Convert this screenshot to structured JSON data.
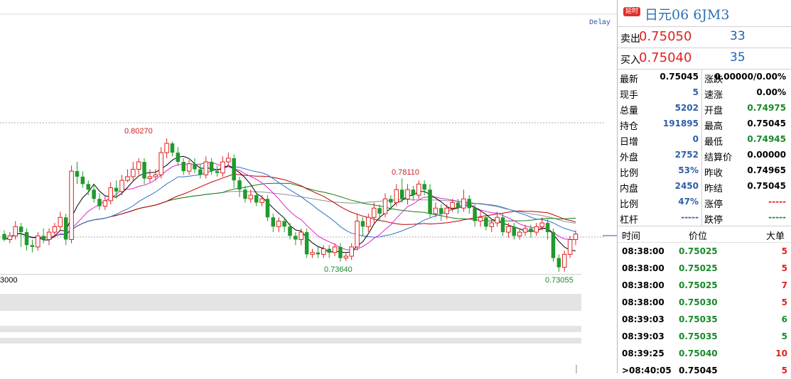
{
  "chart": {
    "delay_label": "Delay",
    "labels": {
      "high1": "0.80270",
      "high2": "0.78110",
      "low1": "0.73640",
      "low2": "0.73055",
      "left_edge": "3000"
    },
    "colors": {
      "up": "#e02020",
      "down": "#1f9a2c",
      "ma_black": "#000000",
      "ma_magenta": "#e020d0",
      "ma_blue": "#3070d0",
      "ma_green": "#108010",
      "ma_gray": "#909090",
      "ma_darkred": "#c00000"
    }
  },
  "chart_data": {
    "type": "candlestick",
    "note_high": 0.8027,
    "note_low": 0.73055,
    "candles": [
      [
        0.751,
        0.748,
        0.753,
        0.747
      ],
      [
        0.748,
        0.75,
        0.752,
        0.746
      ],
      [
        0.75,
        0.755,
        0.758,
        0.748
      ],
      [
        0.755,
        0.752,
        0.757,
        0.744
      ],
      [
        0.752,
        0.745,
        0.754,
        0.742
      ],
      [
        0.745,
        0.744,
        0.748,
        0.741
      ],
      [
        0.744,
        0.75,
        0.752,
        0.742
      ],
      [
        0.75,
        0.748,
        0.754,
        0.746
      ],
      [
        0.748,
        0.752,
        0.754,
        0.745
      ],
      [
        0.752,
        0.755,
        0.757,
        0.749
      ],
      [
        0.755,
        0.76,
        0.763,
        0.753
      ],
      [
        0.76,
        0.748,
        0.762,
        0.745
      ],
      [
        0.748,
        0.785,
        0.788,
        0.746
      ],
      [
        0.785,
        0.782,
        0.79,
        0.778
      ],
      [
        0.782,
        0.778,
        0.785,
        0.776
      ],
      [
        0.778,
        0.775,
        0.78,
        0.772
      ],
      [
        0.775,
        0.77,
        0.778,
        0.768
      ],
      [
        0.77,
        0.766,
        0.773,
        0.764
      ],
      [
        0.766,
        0.769,
        0.772,
        0.764
      ],
      [
        0.769,
        0.776,
        0.779,
        0.767
      ],
      [
        0.776,
        0.774,
        0.78,
        0.77
      ],
      [
        0.774,
        0.78,
        0.783,
        0.772
      ],
      [
        0.78,
        0.782,
        0.786,
        0.779
      ],
      [
        0.782,
        0.786,
        0.79,
        0.78
      ],
      [
        0.786,
        0.79,
        0.792,
        0.783
      ],
      [
        0.79,
        0.781,
        0.792,
        0.778
      ],
      [
        0.781,
        0.782,
        0.786,
        0.779
      ],
      [
        0.782,
        0.783,
        0.786,
        0.78
      ],
      [
        0.783,
        0.795,
        0.798,
        0.781
      ],
      [
        0.795,
        0.8,
        0.8027,
        0.792
      ],
      [
        0.8,
        0.795,
        0.801,
        0.793
      ],
      [
        0.795,
        0.79,
        0.798,
        0.788
      ],
      [
        0.79,
        0.785,
        0.792,
        0.783
      ],
      [
        0.785,
        0.789,
        0.791,
        0.783
      ],
      [
        0.789,
        0.786,
        0.792,
        0.784
      ],
      [
        0.786,
        0.783,
        0.789,
        0.781
      ],
      [
        0.783,
        0.79,
        0.793,
        0.781
      ],
      [
        0.79,
        0.785,
        0.792,
        0.783
      ],
      [
        0.785,
        0.784,
        0.788,
        0.782
      ],
      [
        0.784,
        0.79,
        0.793,
        0.782
      ],
      [
        0.79,
        0.792,
        0.795,
        0.788
      ],
      [
        0.792,
        0.78,
        0.794,
        0.776
      ],
      [
        0.78,
        0.775,
        0.782,
        0.771
      ],
      [
        0.775,
        0.77,
        0.777,
        0.768
      ],
      [
        0.77,
        0.772,
        0.775,
        0.768
      ],
      [
        0.772,
        0.768,
        0.774,
        0.766
      ],
      [
        0.768,
        0.77,
        0.772,
        0.766
      ],
      [
        0.77,
        0.76,
        0.772,
        0.758
      ],
      [
        0.76,
        0.755,
        0.762,
        0.752
      ],
      [
        0.755,
        0.758,
        0.76,
        0.752
      ],
      [
        0.758,
        0.755,
        0.76,
        0.752
      ],
      [
        0.755,
        0.75,
        0.757,
        0.748
      ],
      [
        0.75,
        0.748,
        0.752,
        0.745
      ],
      [
        0.748,
        0.752,
        0.754,
        0.745
      ],
      [
        0.752,
        0.74,
        0.754,
        0.738
      ],
      [
        0.74,
        0.741,
        0.743,
        0.738
      ],
      [
        0.741,
        0.74,
        0.744,
        0.738
      ],
      [
        0.74,
        0.743,
        0.745,
        0.738
      ],
      [
        0.743,
        0.741,
        0.745,
        0.738
      ],
      [
        0.741,
        0.744,
        0.746,
        0.739
      ],
      [
        0.744,
        0.738,
        0.746,
        0.736
      ],
      [
        0.738,
        0.739,
        0.741,
        0.7364
      ],
      [
        0.739,
        0.744,
        0.746,
        0.737
      ],
      [
        0.744,
        0.758,
        0.762,
        0.742
      ],
      [
        0.758,
        0.755,
        0.76,
        0.75
      ],
      [
        0.755,
        0.76,
        0.762,
        0.752
      ],
      [
        0.76,
        0.765,
        0.768,
        0.757
      ],
      [
        0.765,
        0.762,
        0.767,
        0.758
      ],
      [
        0.762,
        0.77,
        0.773,
        0.76
      ],
      [
        0.77,
        0.768,
        0.772,
        0.764
      ],
      [
        0.768,
        0.775,
        0.778,
        0.766
      ],
      [
        0.775,
        0.77,
        0.7811,
        0.768
      ],
      [
        0.77,
        0.775,
        0.778,
        0.767
      ],
      [
        0.775,
        0.772,
        0.777,
        0.769
      ],
      [
        0.772,
        0.778,
        0.78,
        0.77
      ],
      [
        0.778,
        0.775,
        0.78,
        0.772
      ],
      [
        0.775,
        0.762,
        0.778,
        0.76
      ],
      [
        0.762,
        0.765,
        0.768,
        0.76
      ],
      [
        0.765,
        0.762,
        0.767,
        0.758
      ],
      [
        0.762,
        0.765,
        0.767,
        0.759
      ],
      [
        0.765,
        0.768,
        0.77,
        0.763
      ],
      [
        0.768,
        0.765,
        0.77,
        0.762
      ],
      [
        0.765,
        0.77,
        0.775,
        0.763
      ],
      [
        0.77,
        0.765,
        0.772,
        0.762
      ],
      [
        0.765,
        0.758,
        0.767,
        0.755
      ],
      [
        0.758,
        0.76,
        0.763,
        0.755
      ],
      [
        0.76,
        0.755,
        0.762,
        0.753
      ],
      [
        0.755,
        0.757,
        0.759,
        0.752
      ],
      [
        0.757,
        0.76,
        0.763,
        0.755
      ],
      [
        0.76,
        0.752,
        0.762,
        0.75
      ],
      [
        0.752,
        0.755,
        0.757,
        0.749
      ],
      [
        0.755,
        0.75,
        0.757,
        0.748
      ],
      [
        0.75,
        0.752,
        0.754,
        0.748
      ],
      [
        0.752,
        0.754,
        0.756,
        0.75
      ],
      [
        0.754,
        0.752,
        0.756,
        0.749
      ],
      [
        0.752,
        0.755,
        0.757,
        0.75
      ],
      [
        0.755,
        0.757,
        0.76,
        0.753
      ],
      [
        0.757,
        0.752,
        0.759,
        0.748
      ],
      [
        0.752,
        0.738,
        0.754,
        0.736
      ],
      [
        0.738,
        0.733,
        0.74,
        0.7306
      ],
      [
        0.733,
        0.74,
        0.742,
        0.7306
      ],
      [
        0.74,
        0.748,
        0.75,
        0.738
      ],
      [
        0.748,
        0.751,
        0.753,
        0.745
      ]
    ]
  },
  "panel": {
    "badge": "延时",
    "title": "日元06 6JM3",
    "sell_label": "卖出",
    "sell_price": "0.75050",
    "sell_vol": "33",
    "buy_label": "买入",
    "buy_price": "0.75040",
    "buy_vol": "35",
    "stats": [
      {
        "l1": "最新",
        "v1": "0.75045",
        "c1": "blk",
        "l2": "涨跌",
        "v2": "0.00000/0.00%",
        "c2": "blk"
      },
      {
        "l1": "现手",
        "v1": "5",
        "c1": "blue",
        "l2": "速涨",
        "v2": "0.00%",
        "c2": "blk"
      },
      {
        "l1": "总量",
        "v1": "5202",
        "c1": "blue",
        "l2": "开盘",
        "v2": "0.74975",
        "c2": "grn"
      },
      {
        "l1": "持仓",
        "v1": "191895",
        "c1": "blue",
        "l2": "最高",
        "v2": "0.75045",
        "c2": "blk"
      },
      {
        "l1": "日增",
        "v1": "0",
        "c1": "blue",
        "l2": "最低",
        "v2": "0.74945",
        "c2": "grn"
      },
      {
        "l1": "外盘",
        "v1": "2752",
        "c1": "blue",
        "l2": "结算价",
        "v2": "0.00000",
        "c2": "blk"
      },
      {
        "l1": "比例",
        "v1": "53%",
        "c1": "blue",
        "l2": "昨收",
        "v2": "0.74965",
        "c2": "blk"
      },
      {
        "l1": "内盘",
        "v1": "2450",
        "c1": "blue",
        "l2": "昨结",
        "v2": "0.75045",
        "c2": "blk"
      },
      {
        "l1": "比例",
        "v1": "47%",
        "c1": "blue",
        "l2": "涨停",
        "v2": "-----",
        "c2": "red"
      },
      {
        "l1": "杠杆",
        "v1": "-----",
        "c1": "blue",
        "l2": "跌停",
        "v2": "-----",
        "c2": "grn"
      }
    ],
    "ticks_header": {
      "time": "时间",
      "price": "价位",
      "big": "大单"
    },
    "ticks": [
      {
        "time": "08:38:00",
        "price": "0.75025",
        "qty": "5",
        "pc": "grn",
        "qc": "red"
      },
      {
        "time": "08:38:00",
        "price": "0.75025",
        "qty": "5",
        "pc": "grn",
        "qc": "red"
      },
      {
        "time": "08:38:00",
        "price": "0.75025",
        "qty": "7",
        "pc": "grn",
        "qc": "red"
      },
      {
        "time": "08:38:00",
        "price": "0.75030",
        "qty": "5",
        "pc": "grn",
        "qc": "red"
      },
      {
        "time": "08:39:03",
        "price": "0.75035",
        "qty": "6",
        "pc": "grn",
        "qc": "grn"
      },
      {
        "time": "08:39:03",
        "price": "0.75035",
        "qty": "5",
        "pc": "grn",
        "qc": "grn"
      },
      {
        "time": "08:39:25",
        "price": "0.75040",
        "qty": "10",
        "pc": "grn",
        "qc": "red"
      },
      {
        "time": ">08:40:05",
        "price": "0.75045",
        "qty": "5",
        "pc": "blk",
        "qc": "red"
      }
    ]
  }
}
